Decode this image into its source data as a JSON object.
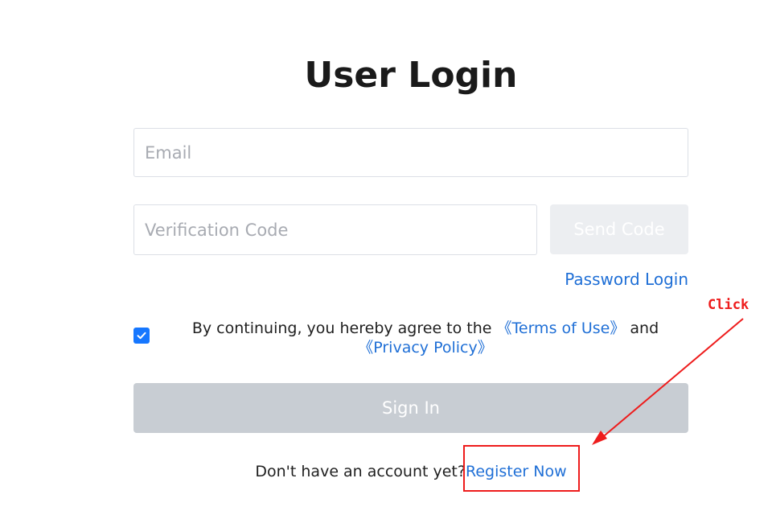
{
  "login": {
    "title": "User Login",
    "email_placeholder": "Email",
    "code_placeholder": "Verification Code",
    "send_code_label": "Send Code",
    "password_login_label": "Password Login",
    "agreement": {
      "checked": true,
      "text_before": "By continuing, you hereby agree to the ",
      "terms_label": "《Terms of Use》",
      "text_between": " and ",
      "privacy_label": "《Privacy Policy》"
    },
    "sign_in_label": "Sign In",
    "no_account_text": "Don't have an account yet?",
    "register_label": "Register Now"
  },
  "annotation": {
    "label": "Click",
    "color": "#ee1c1c"
  },
  "colors": {
    "link": "#1f6fd6",
    "checkbox": "#1677ff",
    "disabled_button": "#c8cdd3",
    "send_button": "#eceef1"
  },
  "icons": {
    "checkbox": "checkmark-icon"
  }
}
